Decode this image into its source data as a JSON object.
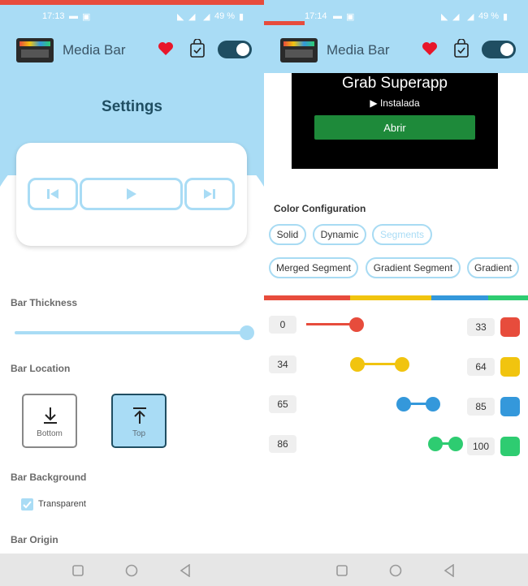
{
  "colors": {
    "accent": "#a9dcf5",
    "red": "#e74c3c",
    "yellow": "#f1c40f",
    "blue": "#3498db",
    "green": "#2ecc71",
    "dark_teal": "#1f4e62"
  },
  "left": {
    "status": {
      "time": "17:13",
      "battery": "49 %"
    },
    "app_title": "Media Bar",
    "page_title": "Settings",
    "player_buttons": [
      "previous-icon",
      "play-icon",
      "next-icon"
    ],
    "bar_thickness": {
      "label": "Bar Thickness",
      "value_fraction": 1.0
    },
    "bar_location": {
      "label": "Bar Location",
      "options": [
        {
          "label": "Bottom",
          "selected": false
        },
        {
          "label": "Top",
          "selected": true
        }
      ]
    },
    "bar_background": {
      "label": "Bar Background",
      "transparent_label": "Transparent",
      "transparent_checked": true
    },
    "bar_origin": {
      "label": "Bar Origin"
    }
  },
  "right": {
    "status": {
      "time": "17:14",
      "battery": "49 %"
    },
    "app_title": "Media Bar",
    "ad": {
      "title": "Grab Superapp",
      "status": "Instalada",
      "button": "Abrir"
    },
    "color_config": {
      "label": "Color Configuration",
      "chips": [
        "Solid",
        "Dynamic",
        "Segments",
        "Merged Segment",
        "Gradient Segment",
        "Gradient"
      ],
      "selected": "Segments"
    },
    "segments": [
      {
        "start": "0",
        "end": "33",
        "color": "#e74c3c"
      },
      {
        "start": "34",
        "end": "64",
        "color": "#f1c40f"
      },
      {
        "start": "65",
        "end": "85",
        "color": "#3498db"
      },
      {
        "start": "86",
        "end": "100",
        "color": "#2ecc71"
      }
    ]
  }
}
